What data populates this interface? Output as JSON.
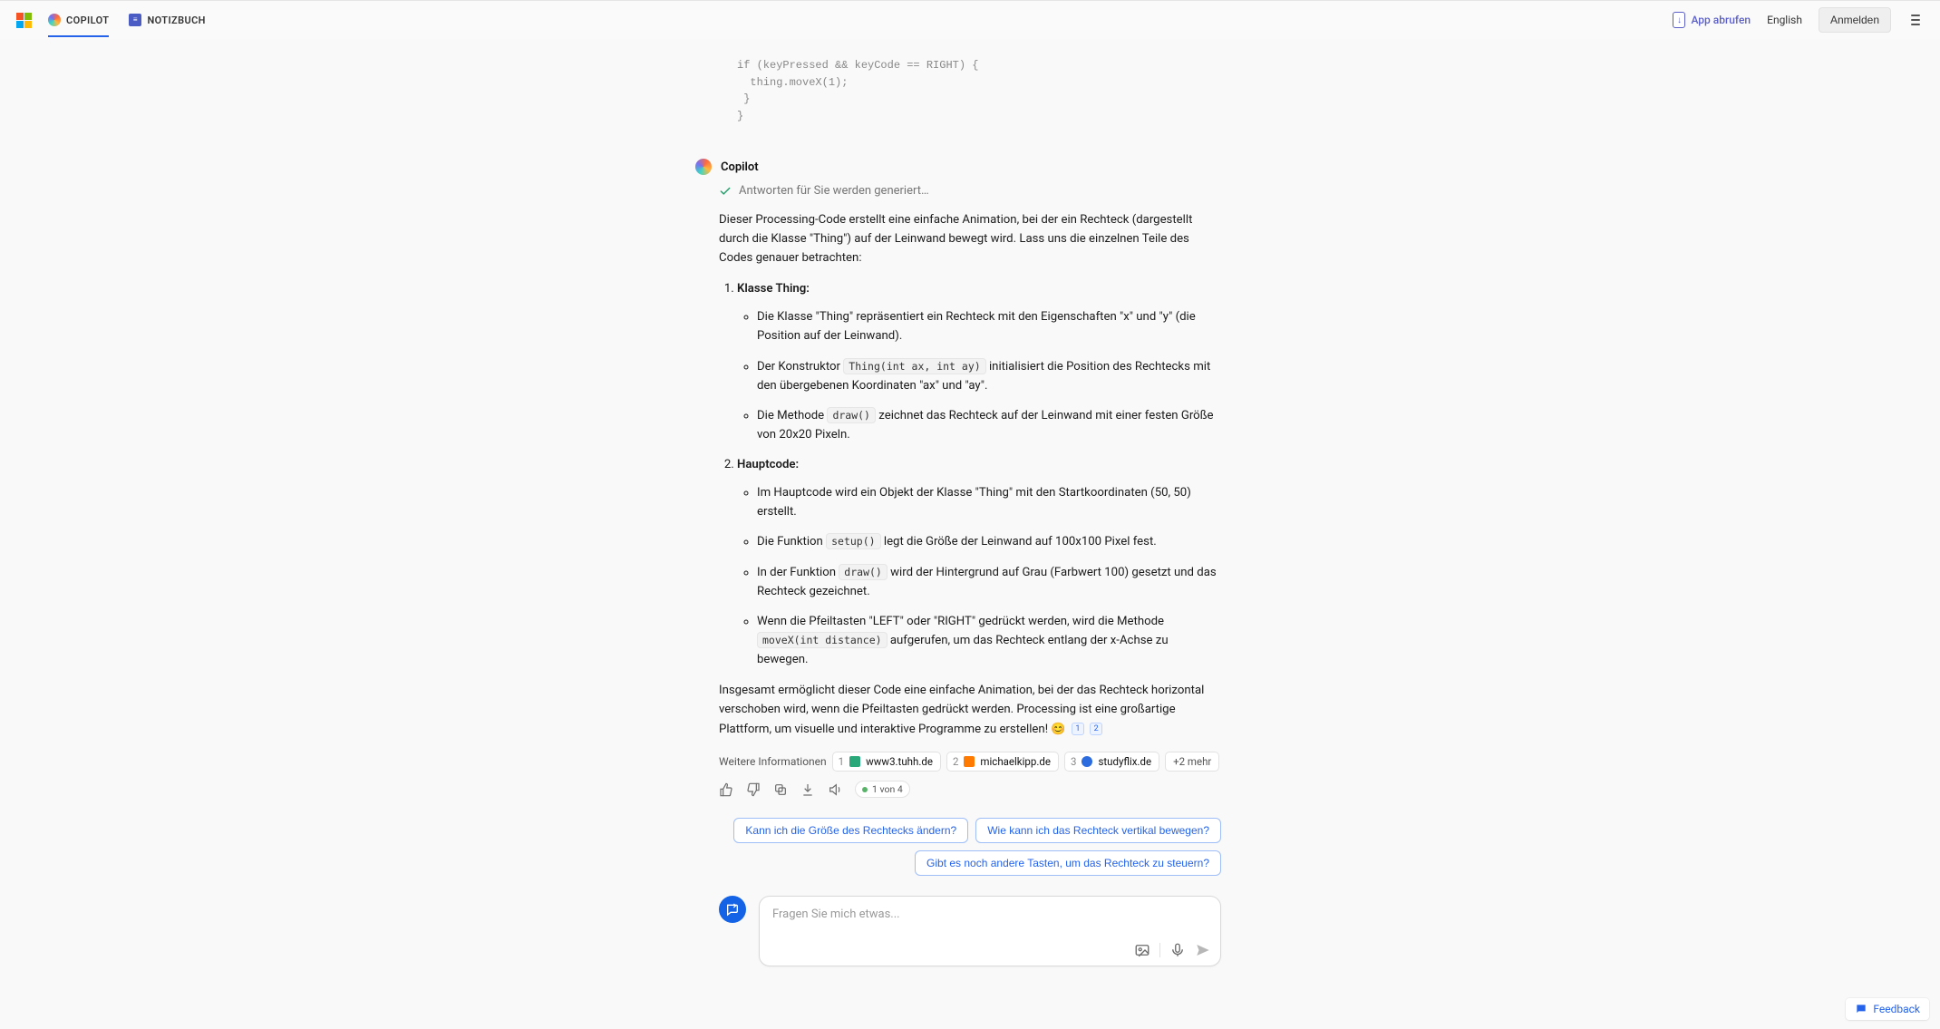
{
  "header": {
    "tab_copilot": "COPILOT",
    "tab_notebook": "NOTIZBUCH",
    "app_link": "App abrufen",
    "language": "English",
    "signin": "Anmelden"
  },
  "code_fragment": "if (keyPressed && keyCode == RIGHT) {\n  thing.moveX(1);\n }\n}",
  "message": {
    "author": "Copilot",
    "generating": "Antworten für Sie werden generiert…",
    "intro": "Dieser Processing-Code erstellt eine einfache Animation, bei der ein Rechteck (dargestellt durch die Klasse \"Thing\") auf der Leinwand bewegt wird. Lass uns die einzelnen Teile des Codes genauer betrachten:",
    "section1_title": "Klasse Thing:",
    "s1_b1": "Die Klasse \"Thing\" repräsentiert ein Rechteck mit den Eigenschaften \"x\" und \"y\" (die Position auf der Leinwand).",
    "s1_b2_pre": "Der Konstruktor ",
    "s1_b2_code": "Thing(int ax, int ay)",
    "s1_b2_post": " initialisiert die Position des Rechtecks mit den übergebenen Koordinaten \"ax\" und \"ay\".",
    "s1_b3_pre": "Die Methode ",
    "s1_b3_code": "draw()",
    "s1_b3_post": " zeichnet das Rechteck auf der Leinwand mit einer festen Größe von 20x20 Pixeln.",
    "section2_title": "Hauptcode:",
    "s2_b1": "Im Hauptcode wird ein Objekt der Klasse \"Thing\" mit den Startkoordinaten (50, 50) erstellt.",
    "s2_b2_pre": "Die Funktion ",
    "s2_b2_code": "setup()",
    "s2_b2_post": " legt die Größe der Leinwand auf 100x100 Pixel fest.",
    "s2_b3_pre": "In der Funktion ",
    "s2_b3_code": "draw()",
    "s2_b3_post": " wird der Hintergrund auf Grau (Farbwert 100) gesetzt und das Rechteck gezeichnet.",
    "s2_b4_pre": "Wenn die Pfeiltasten \"LEFT\" oder \"RIGHT\" gedrückt werden, wird die Methode ",
    "s2_b4_code": "moveX(int distance)",
    "s2_b4_post": " aufgerufen, um das Rechteck entlang der x-Achse zu bewegen.",
    "outro_pre": "Insgesamt ermöglicht dieser Code eine einfache Animation, bei der das Rechteck horizontal verschoben wird, wenn die Pfeiltasten gedrückt werden. Processing ist eine großartige Plattform, um visuelle und interaktive Programme zu erstellen! ",
    "emoji": "😊",
    "cite1": "1",
    "cite2": "2"
  },
  "sources": {
    "label": "Weitere Informationen",
    "items": [
      {
        "num": "1",
        "host": "www3.tuhh.de",
        "favicon": "tuhh"
      },
      {
        "num": "2",
        "host": "michaelkipp.de",
        "favicon": "mk"
      },
      {
        "num": "3",
        "host": "studyflix.de",
        "favicon": "sf"
      }
    ],
    "more": "+2 mehr"
  },
  "actions": {
    "counter": "1 von 4"
  },
  "suggestions": {
    "s1": "Kann ich die Größe des Rechtecks ändern?",
    "s2": "Wie kann ich das Rechteck vertikal bewegen?",
    "s3": "Gibt es noch andere Tasten, um das Rechteck zu steuern?"
  },
  "composer": {
    "placeholder": "Fragen Sie mich etwas..."
  },
  "feedback": "Feedback"
}
